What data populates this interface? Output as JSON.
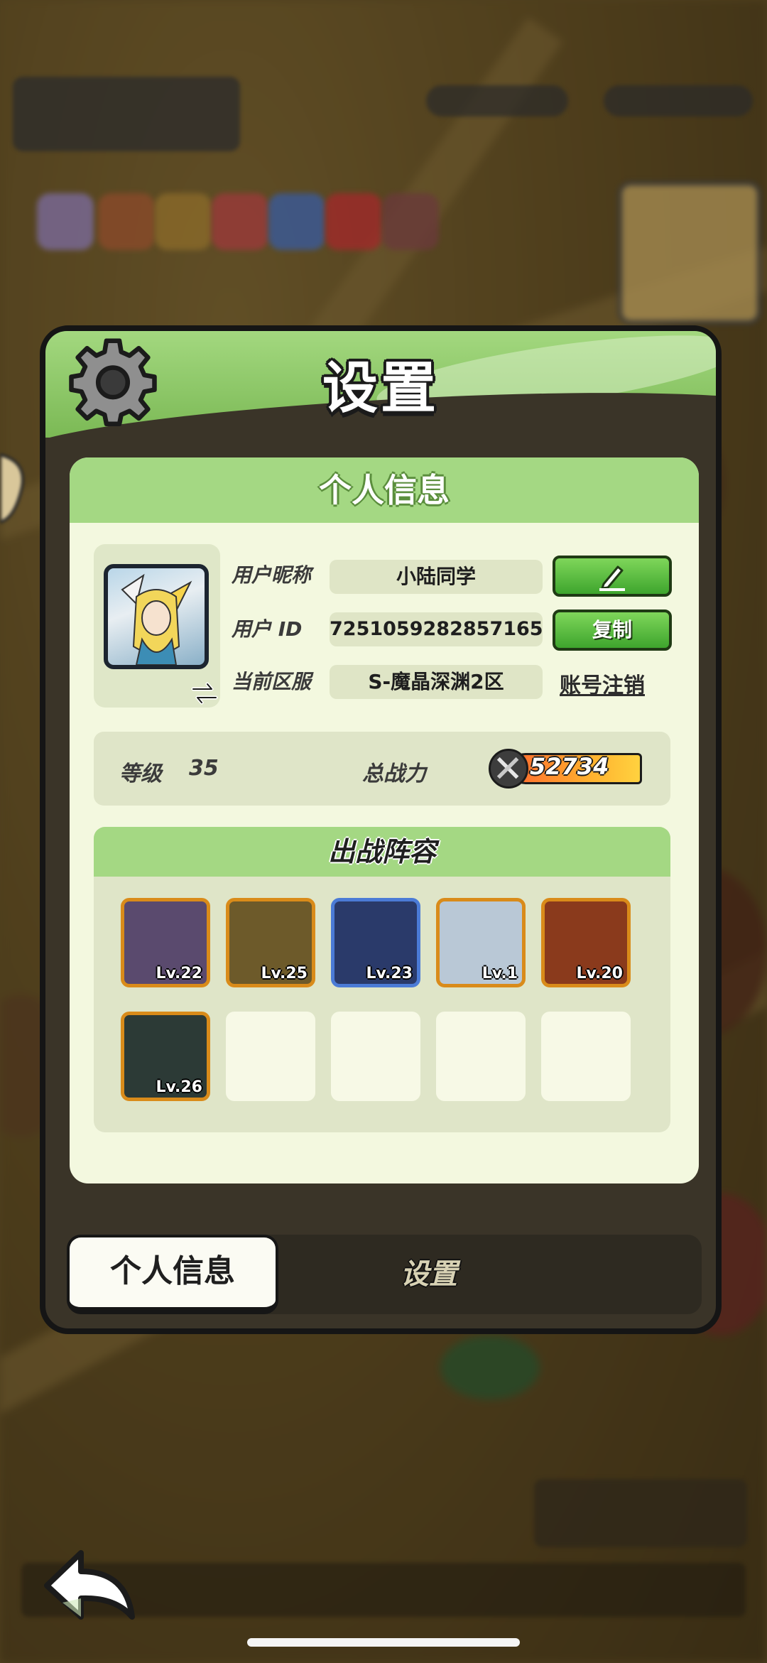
{
  "dialog": {
    "title": "设置",
    "card_title": "个人信息",
    "profile": {
      "nickname_label": "用户昵称",
      "nickname_value": "小陆同学",
      "id_label": "用户  ID",
      "id_value": "7251059282857165",
      "server_label": "当前区服",
      "server_value": "S-魔晶深渊2区",
      "copy_label": "复制",
      "cancel_account_label": "账号注销"
    },
    "stats": {
      "level_label": "等级",
      "level_value": "35",
      "power_label": "总战力",
      "power_value": "52734"
    },
    "lineup": {
      "title": "出战阵容",
      "heroes": [
        {
          "level": "Lv.22",
          "color": "#5a4a6e",
          "frame": "orange"
        },
        {
          "level": "Lv.25",
          "color": "#6d5a2a",
          "frame": "orange"
        },
        {
          "level": "Lv.23",
          "color": "#2a3a6a",
          "frame": "blue"
        },
        {
          "level": "Lv.1",
          "color": "#b9c8d6",
          "frame": "orange"
        },
        {
          "level": "Lv.20",
          "color": "#8a3a1c",
          "frame": "orange"
        },
        {
          "level": "Lv.26",
          "color": "#2c3a36",
          "frame": "orange"
        }
      ]
    },
    "tabs": {
      "profile": "个人信息",
      "settings": "设置"
    }
  },
  "icons": {
    "gear": "gear-icon",
    "edit": "pencil-icon",
    "swap": "swap-arrow-icon",
    "power": "crossed-swords-icon",
    "back": "back-arrow-icon"
  },
  "colors": {
    "accent_green": "#7bb955",
    "button_green": "#3ea52d",
    "hero_frame_orange": "#d98b1a",
    "hero_frame_blue": "#4b7bd6"
  }
}
